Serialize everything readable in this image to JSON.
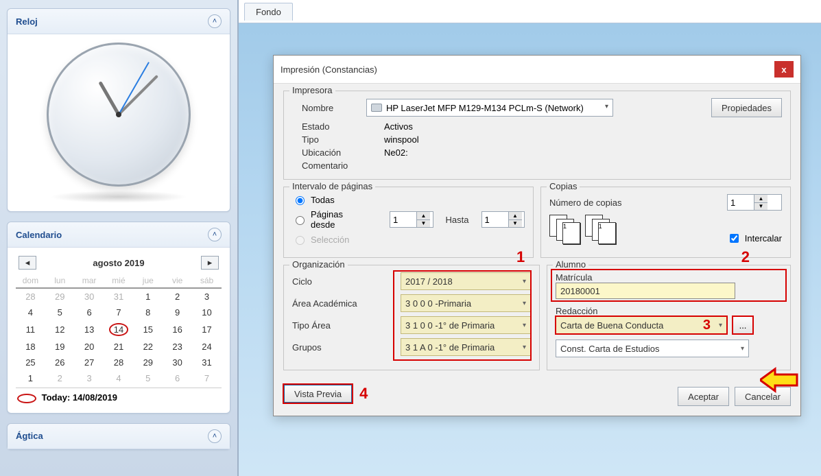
{
  "sidebar": {
    "reloj_title": "Reloj",
    "calendario_title": "Calendario",
    "agtica_title": "Ágtica",
    "cal_month": "agosto 2019",
    "cal_dows": [
      "dom",
      "lun",
      "mar",
      "mié",
      "jue",
      "vie",
      "sáb"
    ],
    "cal_weeks": [
      {
        "dim": [
          28,
          29,
          30,
          31
        ],
        "days": [
          1,
          2,
          3
        ]
      },
      {
        "days": [
          4,
          5,
          6,
          7,
          8,
          9,
          10
        ]
      },
      {
        "days": [
          11,
          12,
          13,
          14,
          15,
          16,
          17
        ],
        "today": 14
      },
      {
        "days": [
          18,
          19,
          20,
          21,
          22,
          23,
          24
        ]
      },
      {
        "days": [
          25,
          26,
          27,
          28,
          29,
          30,
          31
        ]
      },
      {
        "days": [
          1
        ],
        "dim": [
          2,
          3,
          4,
          5,
          6,
          7
        ],
        "lead": true
      }
    ],
    "today_label": "Today: 14/08/2019"
  },
  "tab_fondo": "Fondo",
  "dialog": {
    "title": "Impresión (Constancias)",
    "grp_impresora": "Impresora",
    "lbl_nombre": "Nombre",
    "printer_name": "HP LaserJet MFP M129-M134 PCLm-S (Network)",
    "btn_propiedades": "Propiedades",
    "lbl_estado": "Estado",
    "val_estado": "Activos",
    "lbl_tipo": "Tipo",
    "val_tipo": "winspool",
    "lbl_ubicacion": "Ubicación",
    "val_ubicacion": "Ne02:",
    "lbl_comentario": "Comentario",
    "grp_intervalo": "Intervalo de páginas",
    "opt_todas": "Todas",
    "opt_paginas_desde": "Páginas desde",
    "val_pag_desde": "1",
    "lbl_hasta": "Hasta",
    "val_pag_hasta": "1",
    "opt_seleccion": "Selección",
    "grp_copias": "Copias",
    "lbl_num_copias": "Número de copias",
    "val_num_copias": "1",
    "chk_intercalar": "Intercalar",
    "grp_org": "Organización",
    "lbl_ciclo": "Ciclo",
    "val_ciclo": "2017 / 2018",
    "lbl_area": "Área Académica",
    "val_area": "3 0 0 0 -Primaria",
    "lbl_tipo_area": "Tipo Área",
    "val_tipo_area": "3 1 0 0 -1° de Primaria",
    "lbl_grupos": "Grupos",
    "val_grupos": "3 1 A 0 -1° de Primaria",
    "grp_alumno": "Alumno",
    "lbl_matricula": "Matrícula",
    "val_matricula": "20180001",
    "lbl_redaccion": "Redacción",
    "val_carta": "Carta de Buena Conducta",
    "btn_dots": "...",
    "val_const": "Const. Carta de Estudios",
    "btn_vista": "Vista Previa",
    "btn_aceptar": "Aceptar",
    "btn_cancelar": "Cancelar"
  },
  "annot": {
    "n1": "1",
    "n2": "2",
    "n3": "3",
    "n4": "4"
  }
}
